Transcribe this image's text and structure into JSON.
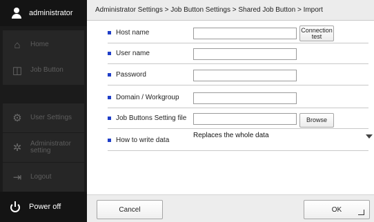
{
  "sidebar": {
    "user": "administrator",
    "items": [
      {
        "label": "Home",
        "icon": "home-icon"
      },
      {
        "label": "Job Button",
        "icon": "job-button-icon"
      },
      {
        "label": "User Settings",
        "icon": "user-settings-icon"
      },
      {
        "label": "Administrator setting",
        "icon": "admin-gear-icon"
      },
      {
        "label": "Logout",
        "icon": "logout-icon"
      }
    ],
    "power_label": "Power off"
  },
  "breadcrumb": "Administrator Settings > Job Button Settings > Shared Job Button > Import",
  "form": {
    "host_name": {
      "label": "Host name",
      "value": ""
    },
    "connection_test": "Connection test",
    "user_name": {
      "label": "User name",
      "value": ""
    },
    "password": {
      "label": "Password",
      "value": ""
    },
    "domain": {
      "label": "Domain / Workgroup",
      "value": ""
    },
    "settings_file": {
      "label": "Job Buttons Setting file",
      "value": ""
    },
    "browse": "Browse",
    "write_mode": {
      "label": "How to write data",
      "value": "Replaces the whole data"
    }
  },
  "footer": {
    "cancel": "Cancel",
    "ok": "OK"
  }
}
